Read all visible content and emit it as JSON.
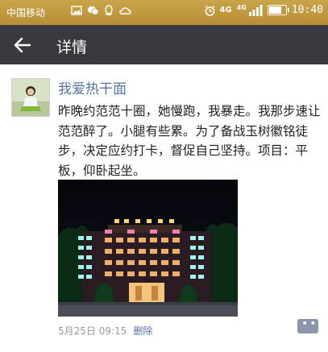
{
  "status_bar": {
    "carrier": "中国移动",
    "network": "4G",
    "network2": "4G",
    "time": "10:40",
    "battery_level": 0.7
  },
  "app_bar": {
    "title": "详情",
    "back_icon": "arrow-left-icon"
  },
  "post": {
    "author": "我爱热干面",
    "text": "昨晚约范范十圈，她慢跑，我暴走。我那步速让范范醉了。小腿有些累。为了备战玉树徽铭徒步，决定应约打卡，督促自己坚持。项目：平板，仰卧起坐。",
    "date": "5月25日 09:15",
    "delete_label": "删除",
    "comment_icon": "comment-icon"
  },
  "colors": {
    "status_bar": "#b88f38",
    "app_bar": "#3a3a3e",
    "link": "#5a72a6"
  }
}
